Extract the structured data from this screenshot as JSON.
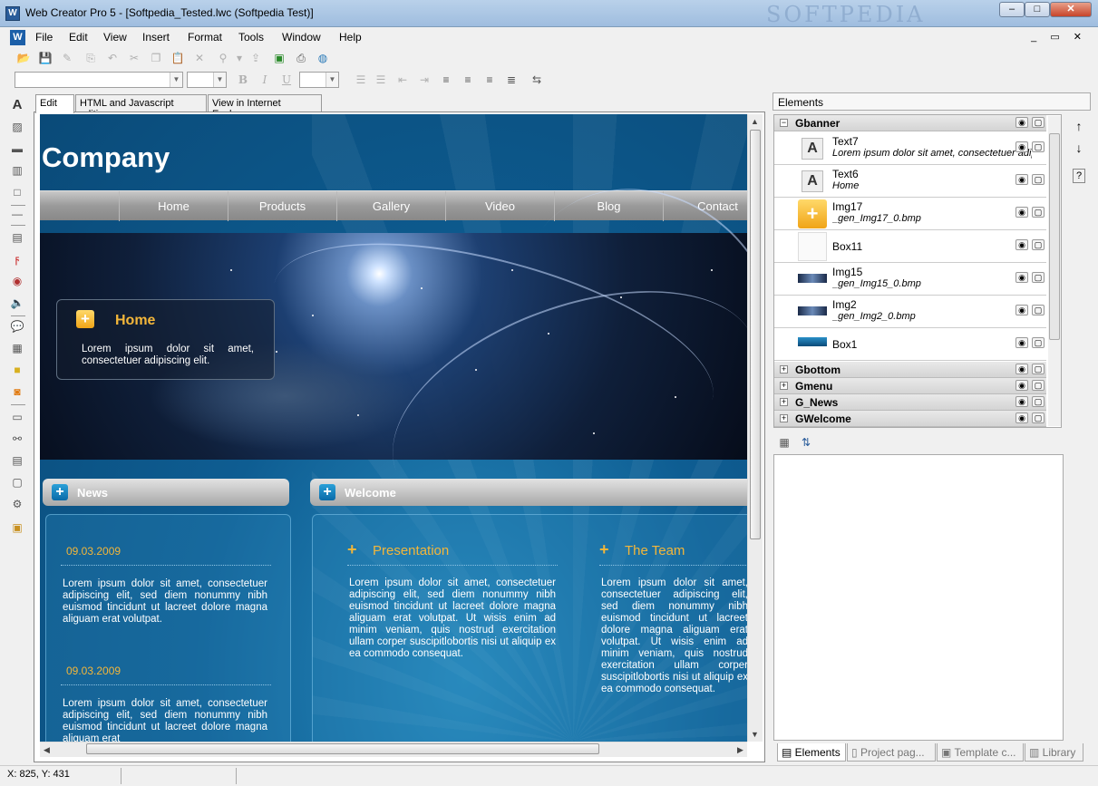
{
  "window": {
    "title": "Web Creator Pro 5 - [Softpedia_Tested.lwc (Softpedia Test)]",
    "watermark": "SOFTPEDIA",
    "app_icon": "W",
    "min_label": "–",
    "max_label": "□",
    "close_label": "✕"
  },
  "menu": {
    "items": [
      "File",
      "Edit",
      "View",
      "Insert",
      "Format",
      "Tools",
      "Window",
      "Help"
    ],
    "mdi_controls": "_ ▭ ✕"
  },
  "toolbar": {
    "icons": [
      "open-icon",
      "save-icon",
      "edit-icon",
      "paste-icon",
      "undo-icon",
      "cut-icon",
      "copy-icon",
      "paste-icon",
      "delete-icon",
      "link-icon",
      "publish-icon",
      "preview-icon",
      "print-icon",
      "globe-icon"
    ],
    "format_icons": [
      "bold-icon",
      "italic-icon",
      "underline-icon"
    ],
    "format_labels": [
      "B",
      "I",
      "U"
    ]
  },
  "editor_tabs": [
    "Edit",
    "HTML and Javascript editing",
    "View in Internet Explorer"
  ],
  "site": {
    "company": "Company",
    "nav": [
      "Home",
      "Products",
      "Gallery",
      "Video",
      "Blog",
      "Contact"
    ],
    "home_box": {
      "title": "Home",
      "text": "Lorem ipsum dolor sit amet, consectetuer adipiscing elit."
    },
    "news": {
      "title": "News",
      "entries": [
        {
          "date": "09.03.2009",
          "text": "Lorem ipsum dolor sit amet, consectetuer adipiscing elit, sed diem nonummy nibh euismod tincidunt ut lacreet dolore magna aliguam erat volutpat."
        },
        {
          "date": "09.03.2009",
          "text": "Lorem ipsum dolor sit amet, consectetuer adipiscing elit, sed diem nonummy nibh euismod tincidunt ut lacreet dolore magna aliguam erat"
        }
      ]
    },
    "welcome": {
      "title": "Welcome",
      "sections": [
        {
          "title": "Presentation",
          "text": "Lorem ipsum dolor sit amet, consectetuer adipiscing elit, sed diem nonummy nibh euismod tincidunt ut lacreet dolore magna aliguam erat volutpat. Ut wisis enim ad minim veniam, quis nostrud exercitation ullam corper suscipitlobortis nisi ut aliquip ex ea commodo consequat."
        },
        {
          "title": "The Team",
          "text": "Lorem ipsum dolor sit amet, consectetuer adipiscing elit, sed diem nonummy nibh euismod tincidunt ut lacreet dolore magna aliguam erat volutpat. Ut wisis enim ad minim veniam, quis nostrud exercitation ullam corper suscipitlobortis nisi ut aliquip ex ea commodo consequat."
        }
      ]
    }
  },
  "elements_panel": {
    "title": "Elements",
    "groups": [
      {
        "name": "Gbanner",
        "expanded": true,
        "items": [
          {
            "name": "Text7",
            "sub": "Lorem ipsum dolor sit amet, consectetuer adipiscing",
            "thumb": "text-icon"
          },
          {
            "name": "Text6",
            "sub": "Home",
            "thumb": "text-icon"
          },
          {
            "name": "Img17",
            "sub": "_gen_Img17_0.bmp",
            "thumb": "plus-image"
          },
          {
            "name": "Box11",
            "sub": "",
            "thumb": "blank"
          },
          {
            "name": "Img15",
            "sub": "_gen_Img15_0.bmp",
            "thumb": "space-image"
          },
          {
            "name": "Img2",
            "sub": "_gen_Img2_0.bmp",
            "thumb": "space-image"
          },
          {
            "name": "Box1",
            "sub": "",
            "thumb": "blue-bar"
          }
        ]
      },
      {
        "name": "Gbottom",
        "expanded": false
      },
      {
        "name": "Gmenu",
        "expanded": false
      },
      {
        "name": "G_News",
        "expanded": false
      },
      {
        "name": "GWelcome",
        "expanded": false
      }
    ],
    "side_buttons": [
      "↑",
      "↓",
      "?"
    ],
    "expand_minus": "−",
    "expand_plus": "+",
    "eye_glyph": "◉",
    "lock_glyph": "🔒",
    "text_thumb_glyph": "A"
  },
  "bottom_tabs": [
    "Elements",
    "Project pag...",
    "Template c...",
    "Library"
  ],
  "status": {
    "coords": "X: 825, Y: 431"
  }
}
